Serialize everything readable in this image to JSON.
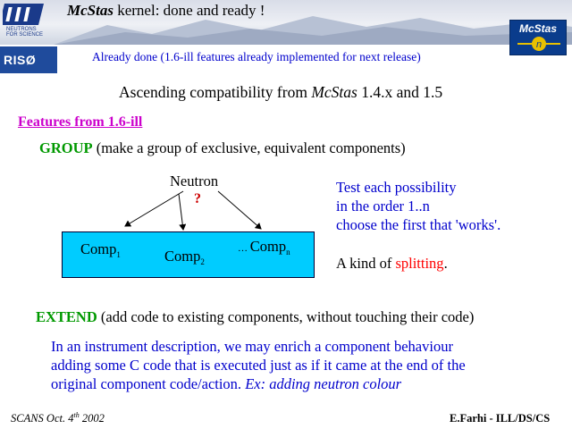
{
  "header": {
    "title_italic": "McStas",
    "title_rest": " kernel: done and ready !"
  },
  "logos": {
    "ill_text_1": "NEUTRONS",
    "ill_text_2": "FOR SCIENCE",
    "mcstas": "McStas",
    "mcstas_symbol": "n",
    "riso": "RISØ"
  },
  "slide": {
    "already_done": "Already done (1.6-ill features already implemented for next release)",
    "ascending_pre": "Ascending compatibility from ",
    "ascending_italic": "McStas",
    "ascending_post": " 1.4.x and 1.5",
    "features_heading": "Features from 1.6-ill",
    "group_keyword": "GROUP",
    "group_text": " (make a group of exclusive, equivalent components)",
    "diagram": {
      "neutron": "Neutron",
      "question": "?",
      "comp1": "Comp",
      "comp1_sub": "1",
      "comp2": "Comp",
      "comp2_sub": "2",
      "compn_prefix": "… ",
      "compn": "Comp",
      "compn_sub": "n"
    },
    "test_lines": [
      "Test each possibility",
      "in the order 1..n",
      "choose the first that 'works'."
    ],
    "kind_pre": "A kind of ",
    "kind_red": "splitting",
    "kind_post": ".",
    "extend_keyword": "EXTEND",
    "extend_text": " (add code to existing components, without touching their code)",
    "desc_lines": [
      "In an instrument description, we may enrich a component behaviour",
      "adding some C code that is executed just as if it came at the end of the"
    ],
    "desc_last_pre": "original component code/action. ",
    "desc_last_italic": "Ex: adding neutron colour"
  },
  "footer": {
    "left_pre": "SCANS Oct. 4",
    "left_sup": "th",
    "left_post": " 2002",
    "right": "E.Farhi - ILL/DS/CS"
  },
  "colors": {
    "blue_text": "#0000cc",
    "green_keyword": "#009900",
    "magenta_heading": "#cc00cc",
    "box_fill": "#00ccff",
    "red": "#ff0000"
  }
}
